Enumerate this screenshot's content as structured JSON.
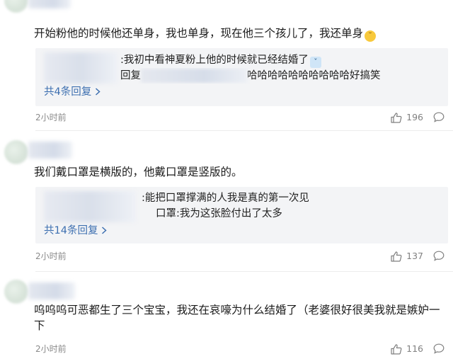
{
  "comments": [
    {
      "text": "开始粉他的时候他还单身，我也单身，现在他三个孩儿了，我还单身",
      "emoji_main": "😅",
      "replies": [
        {
          "text": ":我初中看神夏粉上他的时候就已经结婚了",
          "emoji": "😭"
        },
        {
          "prefix": "回复",
          "text": "哈哈哈哈哈哈哈哈哈哈好搞笑"
        }
      ],
      "more": "共4条回复",
      "time": "2小时前",
      "likes": "196"
    },
    {
      "text": "我们戴口罩是横版的，他戴口罩是竖版的。",
      "replies": [
        {
          "text": ":能把口罩撑满的人我是真的第一次见"
        },
        {
          "text": "口罩:我为这张脸付出了太多"
        }
      ],
      "more": "共14条回复",
      "time": "2小时前",
      "likes": "137"
    },
    {
      "text": "呜呜呜可恶都生了三个宝宝，我还在哀嚎为什么结婚了（老婆很好很美我就是嫉妒一下",
      "time": "2小时前",
      "likes": "116"
    }
  ],
  "icons": {
    "like": "thumbs-up-icon",
    "reply": "comment-bubble-icon",
    "more": "chevron-right-icon"
  },
  "colors": {
    "link": "#3d6fb0",
    "meta": "#8a8a8a",
    "reply_bg": "#f3f4f6"
  }
}
